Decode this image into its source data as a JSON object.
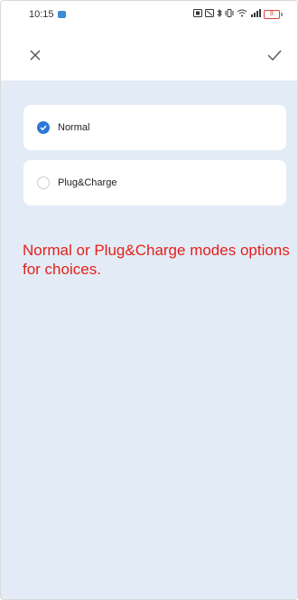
{
  "status_bar": {
    "time": "10:15",
    "battery": "8"
  },
  "header": {
    "close_icon": "close-icon",
    "confirm_icon": "checkmark-icon"
  },
  "options": [
    {
      "label": "Normal",
      "selected": true
    },
    {
      "label": "Plug&Charge",
      "selected": false
    }
  ],
  "annotation": "Normal or Plug&Charge modes options for choices.",
  "colors": {
    "background": "#e3ecf6",
    "accent": "#2c79d6",
    "annotation": "#e3201b"
  }
}
